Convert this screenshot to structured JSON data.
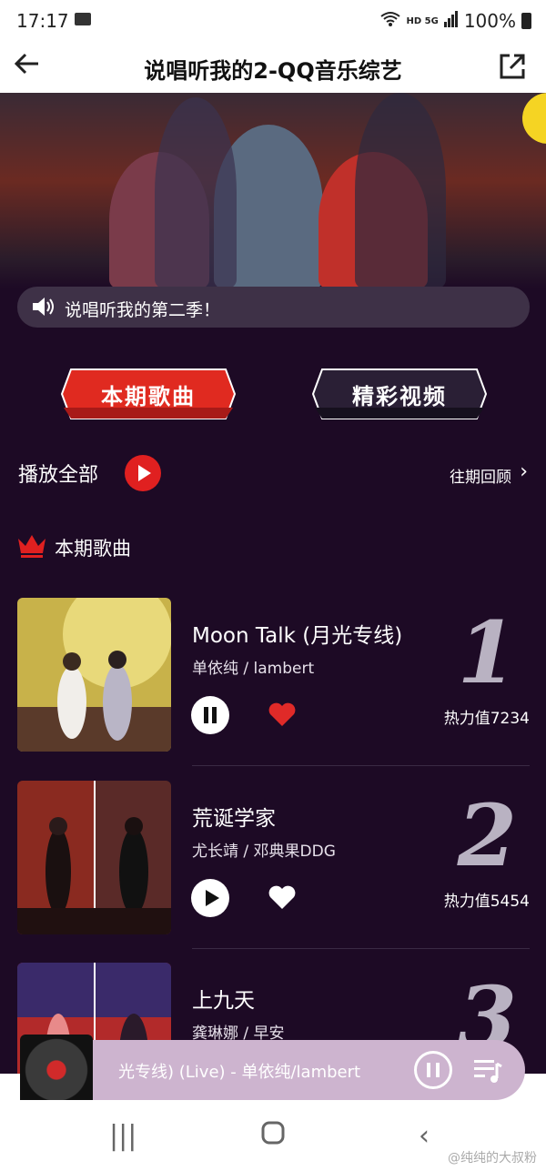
{
  "status_bar": {
    "time": "17:17",
    "network": "HD 5G",
    "battery": "100%"
  },
  "header": {
    "title": "说唱听我的2-QQ音乐综艺"
  },
  "notice": {
    "text": "说唱听我的第二季！"
  },
  "tabs": [
    {
      "label": "本期歌曲",
      "active": true,
      "color": "#e02a20"
    },
    {
      "label": "精彩视频",
      "active": false,
      "color": "#2a1f35"
    }
  ],
  "actions": {
    "play_all": "播放全部",
    "history": "往期回顾"
  },
  "section": {
    "title": "本期歌曲"
  },
  "songs": [
    {
      "rank": "1",
      "name": "Moon Talk (月光专线)",
      "artist": "单依纯 / lambert",
      "heat": "热力值7234",
      "playing": true,
      "liked": true
    },
    {
      "rank": "2",
      "name": "荒诞学家",
      "artist": "尤长靖 / 邓典果DDG",
      "heat": "热力值5454",
      "playing": false,
      "liked": false
    },
    {
      "rank": "3",
      "name": "上九天",
      "artist": "龚琳娜 / 早安",
      "heat": "",
      "playing": false,
      "liked": false
    }
  ],
  "mini_player": {
    "track": "光专线) (Live) - 单依纯/lambert"
  },
  "watermark": "@纯纯的大叔粉",
  "colors": {
    "accent": "#e02020",
    "background": "#1d0a25",
    "mini_player": "#cdb4cf"
  }
}
